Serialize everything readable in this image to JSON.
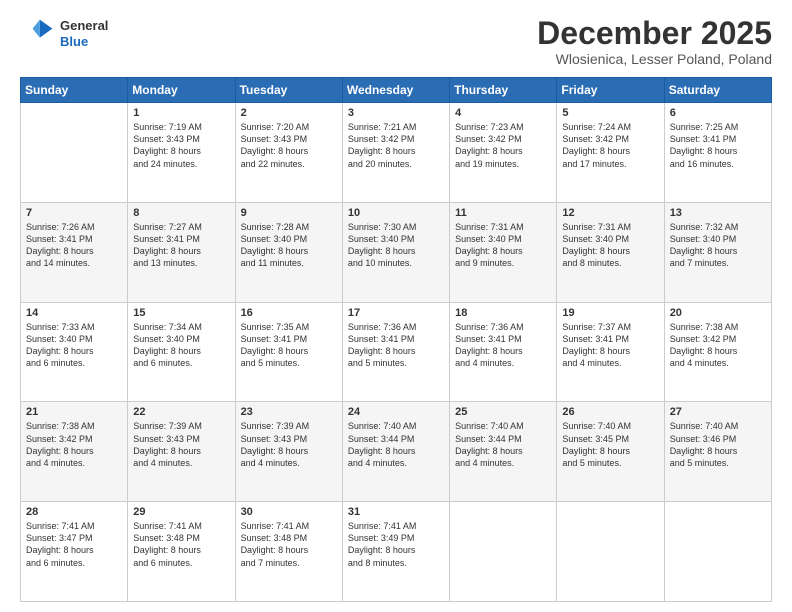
{
  "logo": {
    "line1": "General",
    "line2": "Blue"
  },
  "header": {
    "month": "December 2025",
    "location": "Wlosienica, Lesser Poland, Poland"
  },
  "weekdays": [
    "Sunday",
    "Monday",
    "Tuesday",
    "Wednesday",
    "Thursday",
    "Friday",
    "Saturday"
  ],
  "weeks": [
    [
      {
        "day": "",
        "info": ""
      },
      {
        "day": "1",
        "info": "Sunrise: 7:19 AM\nSunset: 3:43 PM\nDaylight: 8 hours\nand 24 minutes."
      },
      {
        "day": "2",
        "info": "Sunrise: 7:20 AM\nSunset: 3:43 PM\nDaylight: 8 hours\nand 22 minutes."
      },
      {
        "day": "3",
        "info": "Sunrise: 7:21 AM\nSunset: 3:42 PM\nDaylight: 8 hours\nand 20 minutes."
      },
      {
        "day": "4",
        "info": "Sunrise: 7:23 AM\nSunset: 3:42 PM\nDaylight: 8 hours\nand 19 minutes."
      },
      {
        "day": "5",
        "info": "Sunrise: 7:24 AM\nSunset: 3:42 PM\nDaylight: 8 hours\nand 17 minutes."
      },
      {
        "day": "6",
        "info": "Sunrise: 7:25 AM\nSunset: 3:41 PM\nDaylight: 8 hours\nand 16 minutes."
      }
    ],
    [
      {
        "day": "7",
        "info": "Sunrise: 7:26 AM\nSunset: 3:41 PM\nDaylight: 8 hours\nand 14 minutes."
      },
      {
        "day": "8",
        "info": "Sunrise: 7:27 AM\nSunset: 3:41 PM\nDaylight: 8 hours\nand 13 minutes."
      },
      {
        "day": "9",
        "info": "Sunrise: 7:28 AM\nSunset: 3:40 PM\nDaylight: 8 hours\nand 11 minutes."
      },
      {
        "day": "10",
        "info": "Sunrise: 7:30 AM\nSunset: 3:40 PM\nDaylight: 8 hours\nand 10 minutes."
      },
      {
        "day": "11",
        "info": "Sunrise: 7:31 AM\nSunset: 3:40 PM\nDaylight: 8 hours\nand 9 minutes."
      },
      {
        "day": "12",
        "info": "Sunrise: 7:31 AM\nSunset: 3:40 PM\nDaylight: 8 hours\nand 8 minutes."
      },
      {
        "day": "13",
        "info": "Sunrise: 7:32 AM\nSunset: 3:40 PM\nDaylight: 8 hours\nand 7 minutes."
      }
    ],
    [
      {
        "day": "14",
        "info": "Sunrise: 7:33 AM\nSunset: 3:40 PM\nDaylight: 8 hours\nand 6 minutes."
      },
      {
        "day": "15",
        "info": "Sunrise: 7:34 AM\nSunset: 3:40 PM\nDaylight: 8 hours\nand 6 minutes."
      },
      {
        "day": "16",
        "info": "Sunrise: 7:35 AM\nSunset: 3:41 PM\nDaylight: 8 hours\nand 5 minutes."
      },
      {
        "day": "17",
        "info": "Sunrise: 7:36 AM\nSunset: 3:41 PM\nDaylight: 8 hours\nand 5 minutes."
      },
      {
        "day": "18",
        "info": "Sunrise: 7:36 AM\nSunset: 3:41 PM\nDaylight: 8 hours\nand 4 minutes."
      },
      {
        "day": "19",
        "info": "Sunrise: 7:37 AM\nSunset: 3:41 PM\nDaylight: 8 hours\nand 4 minutes."
      },
      {
        "day": "20",
        "info": "Sunrise: 7:38 AM\nSunset: 3:42 PM\nDaylight: 8 hours\nand 4 minutes."
      }
    ],
    [
      {
        "day": "21",
        "info": "Sunrise: 7:38 AM\nSunset: 3:42 PM\nDaylight: 8 hours\nand 4 minutes."
      },
      {
        "day": "22",
        "info": "Sunrise: 7:39 AM\nSunset: 3:43 PM\nDaylight: 8 hours\nand 4 minutes."
      },
      {
        "day": "23",
        "info": "Sunrise: 7:39 AM\nSunset: 3:43 PM\nDaylight: 8 hours\nand 4 minutes."
      },
      {
        "day": "24",
        "info": "Sunrise: 7:40 AM\nSunset: 3:44 PM\nDaylight: 8 hours\nand 4 minutes."
      },
      {
        "day": "25",
        "info": "Sunrise: 7:40 AM\nSunset: 3:44 PM\nDaylight: 8 hours\nand 4 minutes."
      },
      {
        "day": "26",
        "info": "Sunrise: 7:40 AM\nSunset: 3:45 PM\nDaylight: 8 hours\nand 5 minutes."
      },
      {
        "day": "27",
        "info": "Sunrise: 7:40 AM\nSunset: 3:46 PM\nDaylight: 8 hours\nand 5 minutes."
      }
    ],
    [
      {
        "day": "28",
        "info": "Sunrise: 7:41 AM\nSunset: 3:47 PM\nDaylight: 8 hours\nand 6 minutes."
      },
      {
        "day": "29",
        "info": "Sunrise: 7:41 AM\nSunset: 3:48 PM\nDaylight: 8 hours\nand 6 minutes."
      },
      {
        "day": "30",
        "info": "Sunrise: 7:41 AM\nSunset: 3:48 PM\nDaylight: 8 hours\nand 7 minutes."
      },
      {
        "day": "31",
        "info": "Sunrise: 7:41 AM\nSunset: 3:49 PM\nDaylight: 8 hours\nand 8 minutes."
      },
      {
        "day": "",
        "info": ""
      },
      {
        "day": "",
        "info": ""
      },
      {
        "day": "",
        "info": ""
      }
    ]
  ]
}
